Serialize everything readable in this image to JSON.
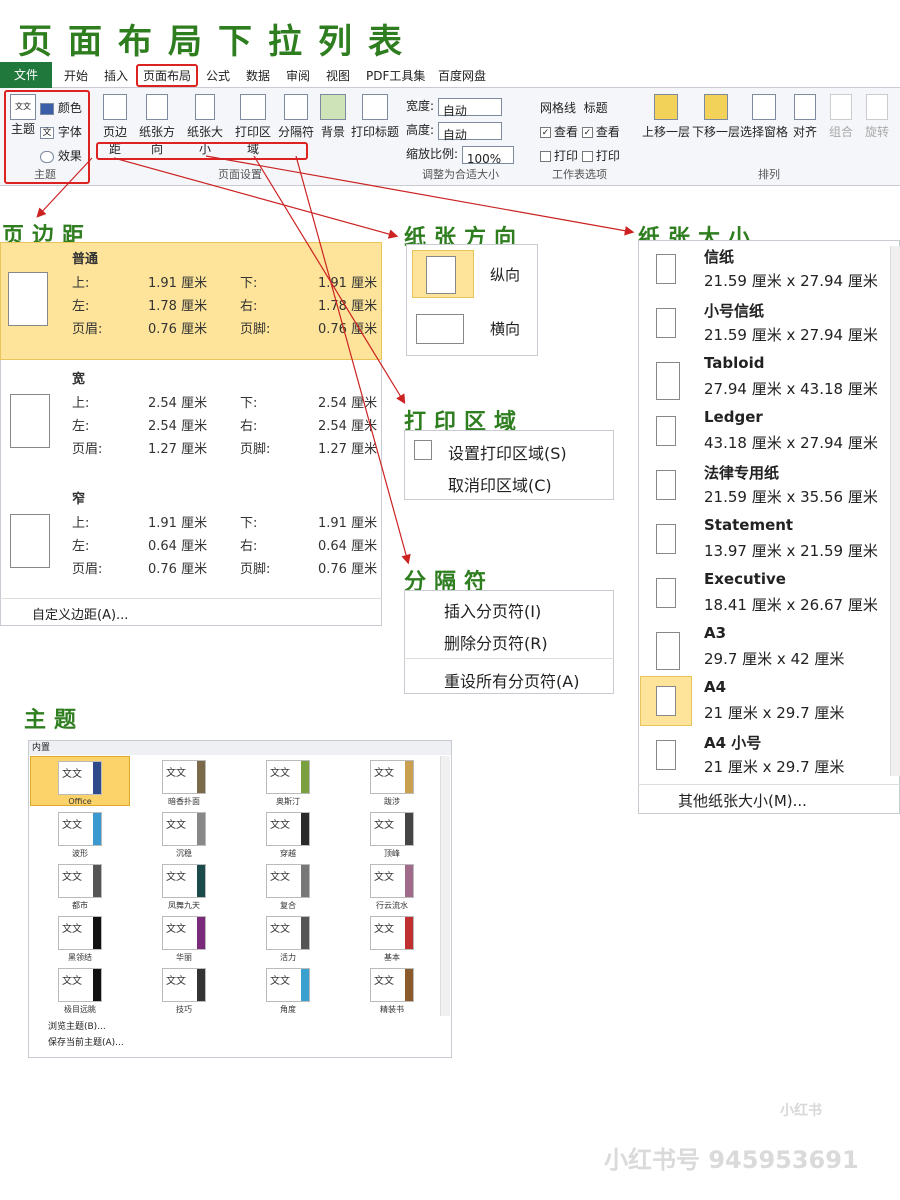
{
  "page_title": "页面布局下拉列表",
  "tabs": [
    "文件",
    "开始",
    "插入",
    "页面布局",
    "公式",
    "数据",
    "审阅",
    "视图",
    "PDF工具集",
    "百度网盘"
  ],
  "ribbon": {
    "theme_group": {
      "main": "主题",
      "items": [
        "颜色",
        "字体",
        "效果"
      ],
      "label": "主题"
    },
    "page_setup": {
      "buttons": [
        "页边距",
        "纸张方向",
        "纸张大小",
        "打印区域",
        "分隔符",
        "背景",
        "打印标题"
      ],
      "label": "页面设置"
    },
    "scale": {
      "width_label": "宽度:",
      "width_value": "自动",
      "height_label": "高度:",
      "height_value": "自动",
      "scale_label": "缩放比例:",
      "scale_value": "100%",
      "label": "调整为合适大小"
    },
    "sheet_options": {
      "gridlines": "网格线",
      "headings": "标题",
      "view1": "查看",
      "view2": "查看",
      "print1": "打印",
      "print2": "打印",
      "label": "工作表选项"
    },
    "arrange": {
      "buttons": [
        "上移一层",
        "下移一层",
        "选择窗格",
        "对齐",
        "组合",
        "旋转"
      ],
      "label": "排列"
    }
  },
  "margins": {
    "title": "页边距",
    "presets": [
      {
        "name": "普通",
        "top_l": "上:",
        "top_v": "1.91 厘米",
        "bot_l": "下:",
        "bot_v": "1.91 厘米",
        "left_l": "左:",
        "left_v": "1.78 厘米",
        "right_l": "右:",
        "right_v": "1.78 厘米",
        "hdr_l": "页眉:",
        "hdr_v": "0.76 厘米",
        "ftr_l": "页脚:",
        "ftr_v": "0.76 厘米"
      },
      {
        "name": "宽",
        "top_l": "上:",
        "top_v": "2.54 厘米",
        "bot_l": "下:",
        "bot_v": "2.54 厘米",
        "left_l": "左:",
        "left_v": "2.54 厘米",
        "right_l": "右:",
        "right_v": "2.54 厘米",
        "hdr_l": "页眉:",
        "hdr_v": "1.27 厘米",
        "ftr_l": "页脚:",
        "ftr_v": "1.27 厘米"
      },
      {
        "name": "窄",
        "top_l": "上:",
        "top_v": "1.91 厘米",
        "bot_l": "下:",
        "bot_v": "1.91 厘米",
        "left_l": "左:",
        "left_v": "0.64 厘米",
        "right_l": "右:",
        "right_v": "0.64 厘米",
        "hdr_l": "页眉:",
        "hdr_v": "0.76 厘米",
        "ftr_l": "页脚:",
        "ftr_v": "0.76 厘米"
      }
    ],
    "custom": "自定义边距(A)..."
  },
  "orientation": {
    "title": "纸张方向",
    "portrait": "纵向",
    "landscape": "横向"
  },
  "print_area": {
    "title": "打印区域",
    "set": "设置打印区域(S)",
    "clear": "取消印区域(C)"
  },
  "breaks": {
    "title": "分隔符",
    "insert": "插入分页符(I)",
    "remove": "删除分页符(R)",
    "reset": "重设所有分页符(A)"
  },
  "paper_size": {
    "title": "纸张大小",
    "items": [
      {
        "name": "信纸",
        "size": "21.59 厘米 x 27.94 厘米"
      },
      {
        "name": "小号信纸",
        "size": "21.59 厘米 x 27.94 厘米"
      },
      {
        "name": "Tabloid",
        "size": "27.94 厘米 x 43.18 厘米"
      },
      {
        "name": "Ledger",
        "size": "43.18 厘米 x 27.94 厘米"
      },
      {
        "name": "法律专用纸",
        "size": "21.59 厘米 x 35.56 厘米"
      },
      {
        "name": "Statement",
        "size": "13.97 厘米 x 21.59 厘米"
      },
      {
        "name": "Executive",
        "size": "18.41 厘米 x 26.67 厘米"
      },
      {
        "name": "A3",
        "size": "29.7 厘米 x 42 厘米"
      },
      {
        "name": "A4",
        "size": "21 厘米 x 29.7 厘米"
      },
      {
        "name": "A4 小号",
        "size": "21 厘米 x 29.7 厘米"
      }
    ],
    "more": "其他纸张大小(M)..."
  },
  "themes": {
    "title": "主题",
    "header": "内置",
    "thumb_text": "文文",
    "names": [
      "Office",
      "暗香扑面",
      "奥斯汀",
      "跋涉",
      "波形",
      "沉稳",
      "穿越",
      "顶峰",
      "都市",
      "凤舞九天",
      "复合",
      "行云流水",
      "黑领结",
      "华丽",
      "活力",
      "基本",
      "极目远眺",
      "技巧",
      "角度",
      "精装书"
    ],
    "accents": [
      "#2f4a8a",
      "#7a6a4a",
      "#7aa040",
      "#c8a050",
      "#3a9ad0",
      "#888888",
      "#2a2a2a",
      "#444444",
      "#555555",
      "#1a4a4a",
      "#777777",
      "#a06a8a",
      "#111111",
      "#7a2a7a",
      "#555555",
      "#c03030",
      "#111111",
      "#333333",
      "#3aa0d0",
      "#8a5a2a"
    ],
    "browse": "浏览主题(B)...",
    "save": "保存当前主题(A)..."
  },
  "watermark": {
    "brand": "小红书",
    "id": "小红书号 945953691"
  },
  "colors": {
    "accent_green": "#2e7d1f",
    "highlight": "#fde49a",
    "red": "#d22222",
    "file_tab": "#21783c"
  }
}
